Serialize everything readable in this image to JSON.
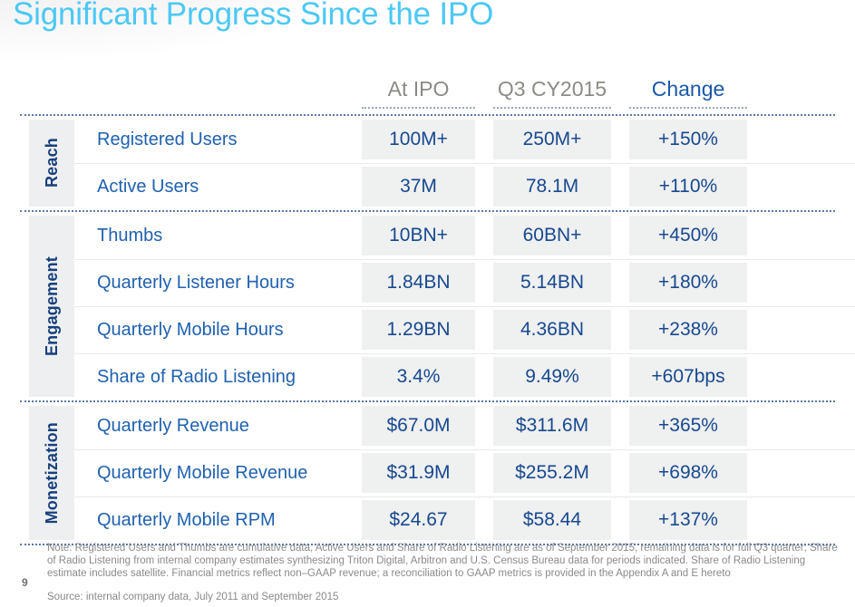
{
  "slide": {
    "title": "Significant Progress Since the IPO",
    "page_number": "9",
    "accent_title_color": "#4cc8f5",
    "label_blue": "#1f61b0",
    "value_blue": "#17498f",
    "header_gray": "#8b8b86",
    "cell_bg": "#eff0f0"
  },
  "table": {
    "headers": {
      "category": "",
      "metric": "",
      "at_ipo": "At IPO",
      "q3_cy2015": "Q3 CY2015",
      "change": "Change"
    },
    "sections": [
      {
        "category": "Reach",
        "rows": [
          {
            "metric": "Registered Users",
            "at_ipo": "100M+",
            "q3_cy2015": "250M+",
            "change": "+150%"
          },
          {
            "metric": "Active Users",
            "at_ipo": "37M",
            "q3_cy2015": "78.1M",
            "change": "+110%"
          }
        ]
      },
      {
        "category": "Engagement",
        "rows": [
          {
            "metric": "Thumbs",
            "at_ipo": "10BN+",
            "q3_cy2015": "60BN+",
            "change": "+450%"
          },
          {
            "metric": "Quarterly Listener Hours",
            "at_ipo": "1.84BN",
            "q3_cy2015": "5.14BN",
            "change": "+180%"
          },
          {
            "metric": "Quarterly Mobile Hours",
            "at_ipo": "1.29BN",
            "q3_cy2015": "4.36BN",
            "change": "+238%"
          },
          {
            "metric": "Share of Radio Listening",
            "at_ipo": "3.4%",
            "q3_cy2015": "9.49%",
            "change": "+607bps"
          }
        ]
      },
      {
        "category": "Monetization",
        "rows": [
          {
            "metric": "Quarterly Revenue",
            "at_ipo": "$67.0M",
            "q3_cy2015": "$311.6M",
            "change": "+365%"
          },
          {
            "metric": "Quarterly Mobile Revenue",
            "at_ipo": "$31.9M",
            "q3_cy2015": "$255.2M",
            "change": "+698%"
          },
          {
            "metric": "Quarterly Mobile RPM",
            "at_ipo": "$24.67",
            "q3_cy2015": "$58.44",
            "change": "+137%"
          }
        ]
      }
    ]
  },
  "footnotes": {
    "note": "Note: Registered Users and Thumbs are cumulative data, Active Users and Share of Radio Listening are as of September 2015, remaining data is for full Q3 quarter; Share of Radio Listening from internal company estimates synthesizing Triton Digital, Arbitron and U.S. Census Bureau data for periods indicated. Share of Radio Listening estimate includes satellite. Financial metrics reflect non–GAAP revenue; a reconciliation to GAAP metrics is provided in the Appendix A and E hereto",
    "source": "Source: internal company data, July 2011 and September 2015"
  }
}
